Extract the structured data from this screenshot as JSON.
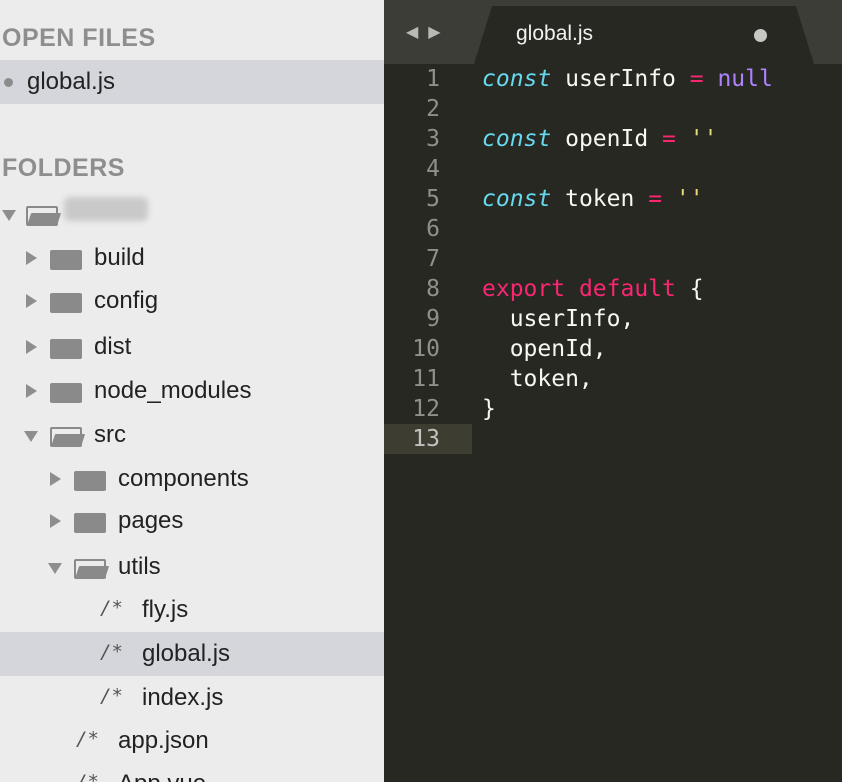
{
  "sidebar": {
    "open_files_title": "OPEN FILES",
    "open_files": [
      {
        "label": "global.js"
      }
    ],
    "folders_title": "FOLDERS",
    "tree": {
      "build": "build",
      "config": "config",
      "dist": "dist",
      "node_modules": "node_modules",
      "src": "src",
      "components": "components",
      "pages": "pages",
      "utils": "utils",
      "fly": "fly.js",
      "global": "global.js",
      "index": "index.js",
      "app_json": "app.json",
      "app_vue": "App.vue"
    },
    "file_icon_glyph": "/*"
  },
  "editor": {
    "tab": {
      "label": "global.js",
      "modified": true
    },
    "nav_arrows": "◀▶",
    "line_numbers": [
      "1",
      "2",
      "3",
      "4",
      "5",
      "6",
      "7",
      "8",
      "9",
      "10",
      "11",
      "12",
      "13"
    ],
    "code": {
      "l1": {
        "kw": "const",
        "id": " userInfo ",
        "op": "=",
        "val": " null"
      },
      "l3": {
        "kw": "const",
        "id": " openId ",
        "op": "=",
        "val": " ''"
      },
      "l5": {
        "kw": "const",
        "id": " token ",
        "op": "=",
        "val": " ''"
      },
      "l8": {
        "kw1": "export",
        "kw2": " default",
        "rest": " {"
      },
      "l9": "  userInfo,",
      "l10": "  openId,",
      "l11": "  token,",
      "l12": "}"
    },
    "colors": {
      "background": "#272822",
      "keyword": "#f92672",
      "storage": "#66d9ef",
      "constant": "#ae81ff",
      "string": "#e6db74"
    }
  }
}
